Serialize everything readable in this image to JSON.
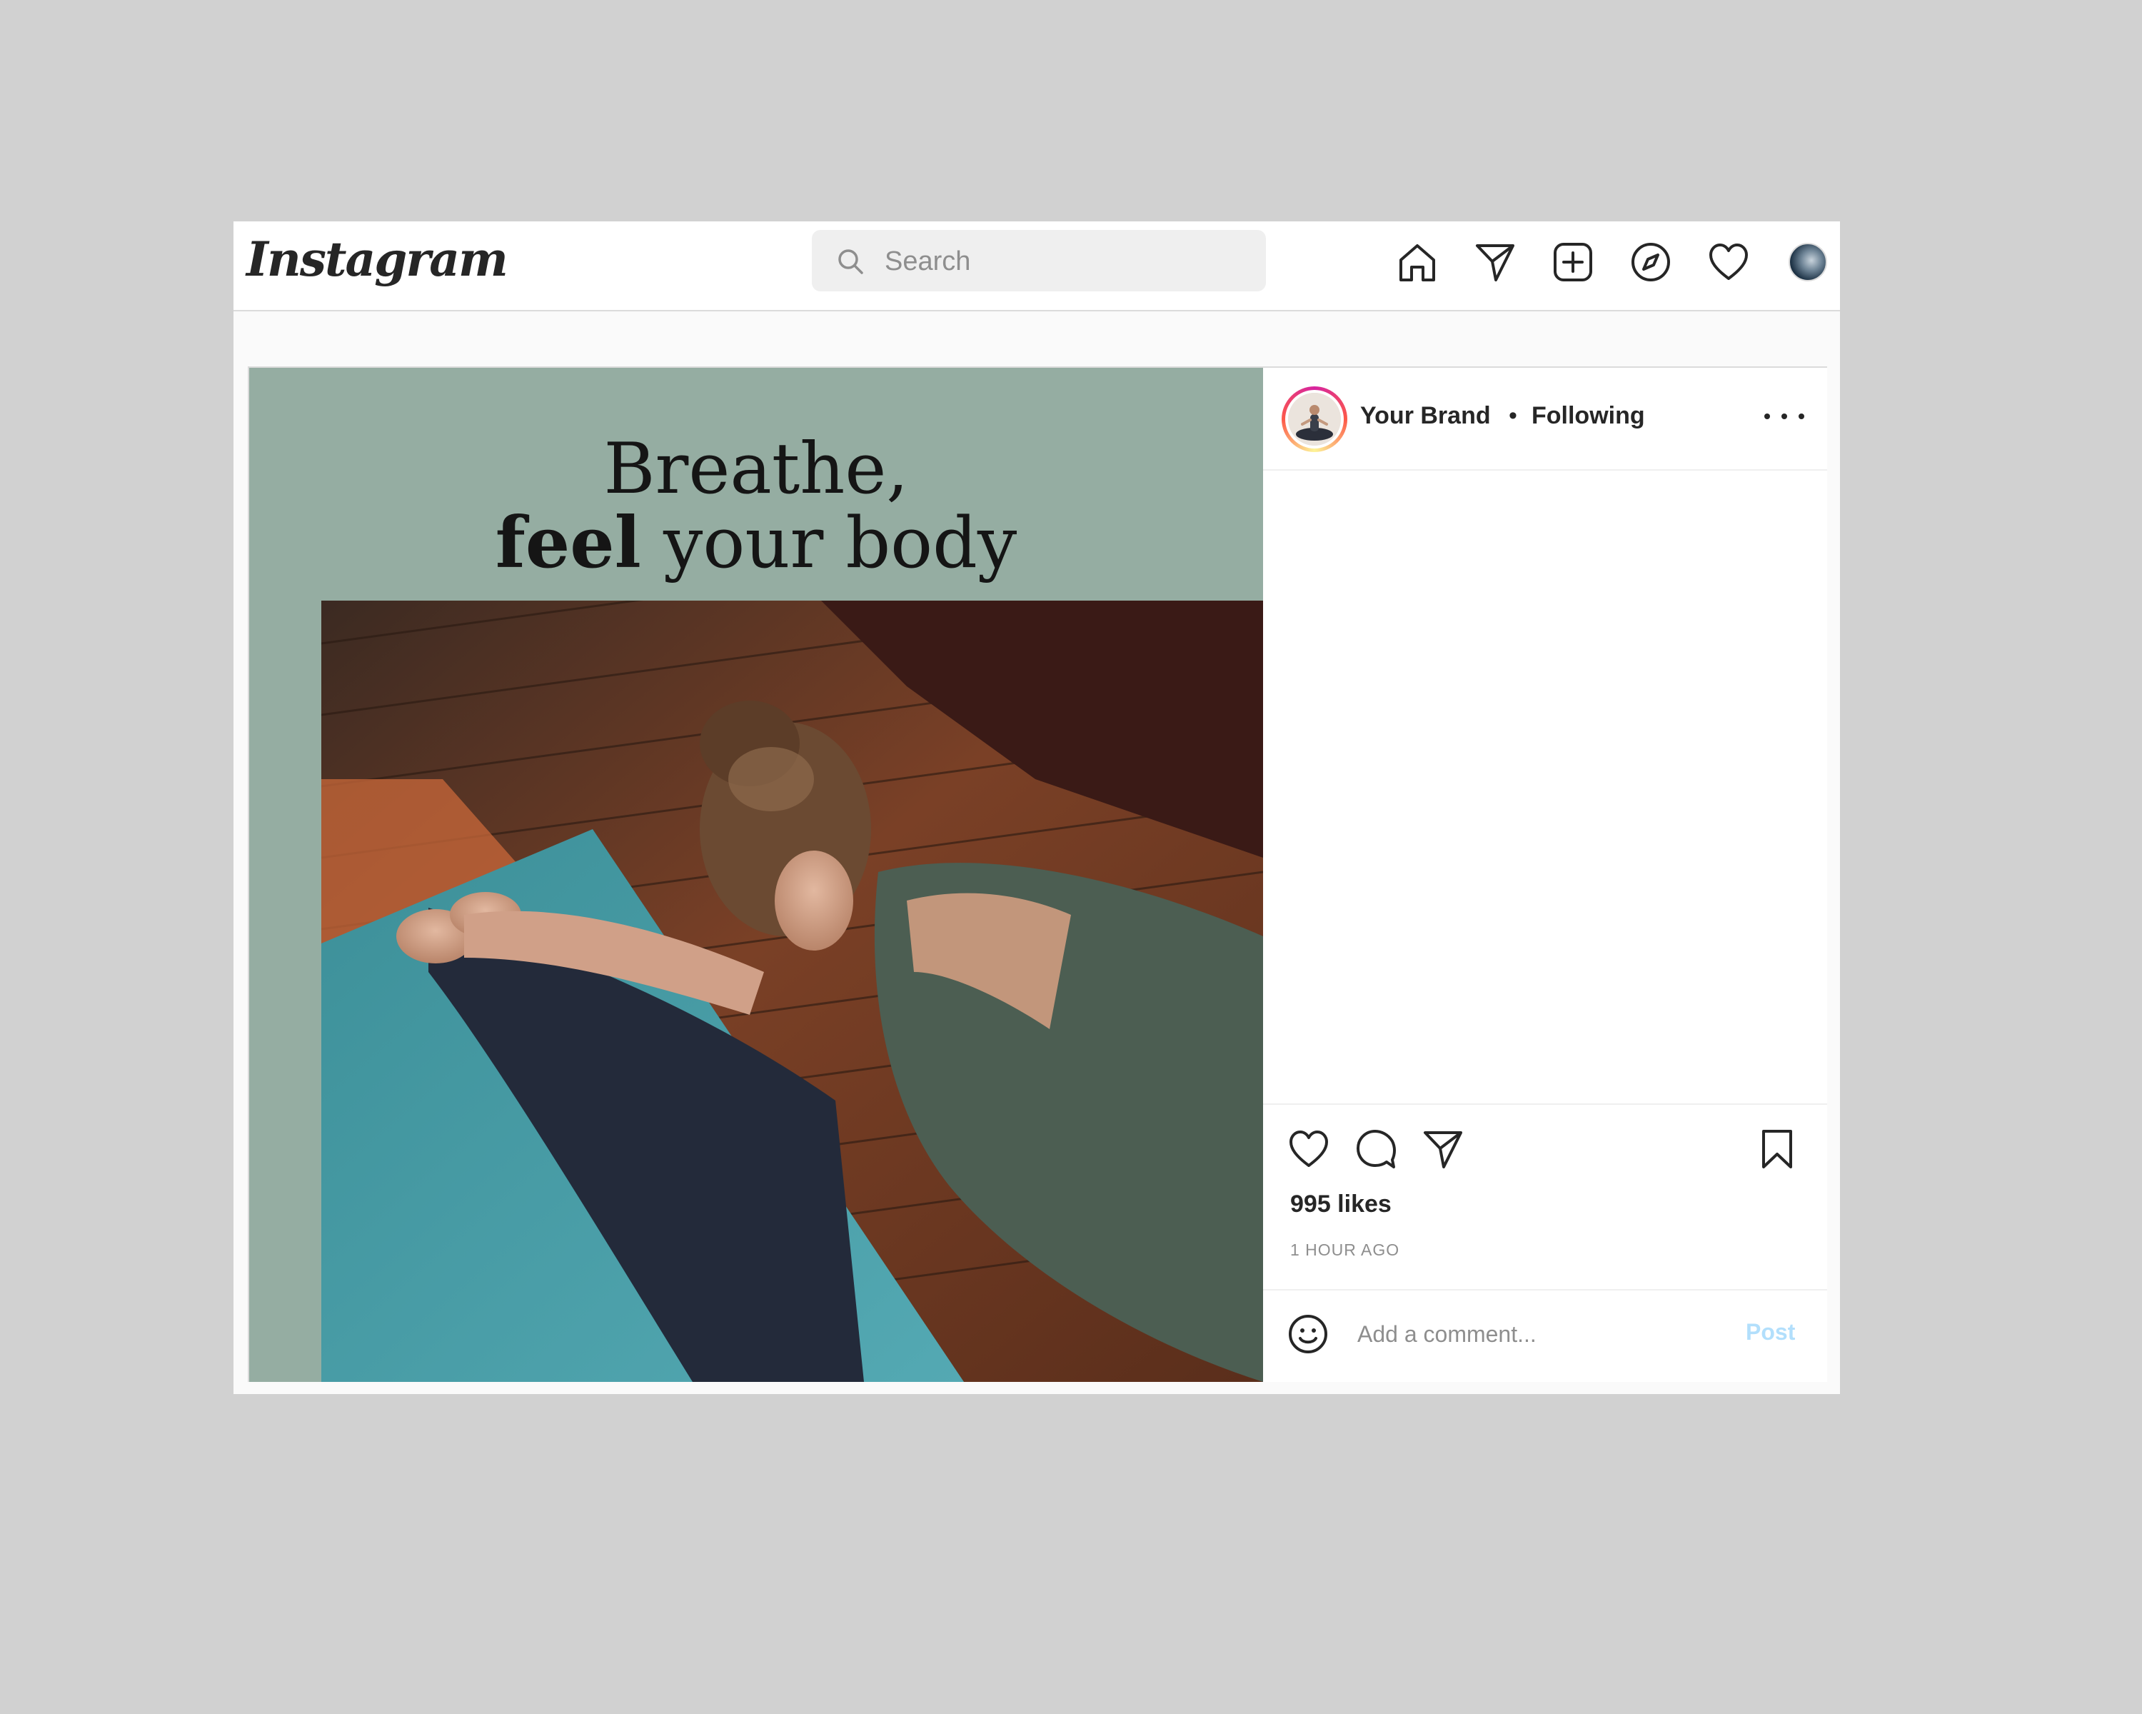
{
  "nav": {
    "logo_text": "Instagram",
    "search_placeholder": "Search",
    "icons": [
      "home-icon",
      "direct-message-icon",
      "new-post-icon",
      "explore-icon",
      "activity-heart-icon"
    ]
  },
  "post": {
    "headline_line1": "Breathe,",
    "headline_bold": "feel",
    "headline_rest": " your body",
    "username": "Your Brand",
    "separator": "•",
    "follow_status": "Following",
    "likes": "995 likes",
    "time_ago": "1 HOUR AGO",
    "comment_placeholder": "Add a comment...",
    "post_label": "Post"
  },
  "colors": {
    "media_background": "#95ada2",
    "post_button": "#b2dffc",
    "text": "#262626",
    "muted": "#8e8e8e"
  }
}
